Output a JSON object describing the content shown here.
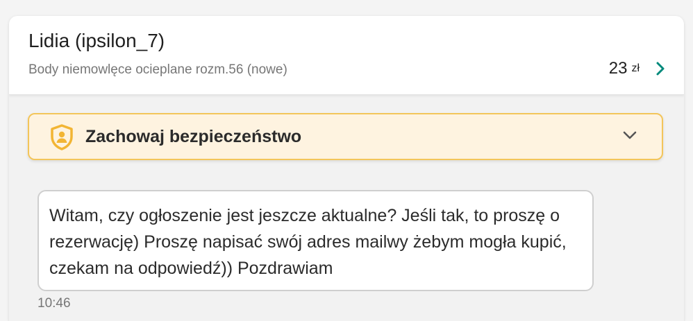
{
  "header": {
    "contact_name": "Lidia (ipsilon_7)",
    "item_title": "Body niemowlęce ocieplane rozm.56 (nowe)",
    "price_amount": "23",
    "price_currency": "zł",
    "chevron_icon": "chevron-right-icon"
  },
  "safety_banner": {
    "label": "Zachowaj bezpieczeństwo",
    "icon": "shield-user-icon",
    "expand_icon": "chevron-down-icon"
  },
  "messages": [
    {
      "text": "Witam, czy ogłoszenie jest jeszcze aktualne? Jeśli tak, to proszę o rezerwację) Proszę napisać swój adres mailwy żebym mogła kupić, czekam na odpowiedź)) Pozdrawiam",
      "time": "10:46"
    }
  ],
  "colors": {
    "accent": "#00897b",
    "banner_background": "#fef3e0",
    "banner_border": "#f3c55a",
    "shield": "#f2b534"
  }
}
